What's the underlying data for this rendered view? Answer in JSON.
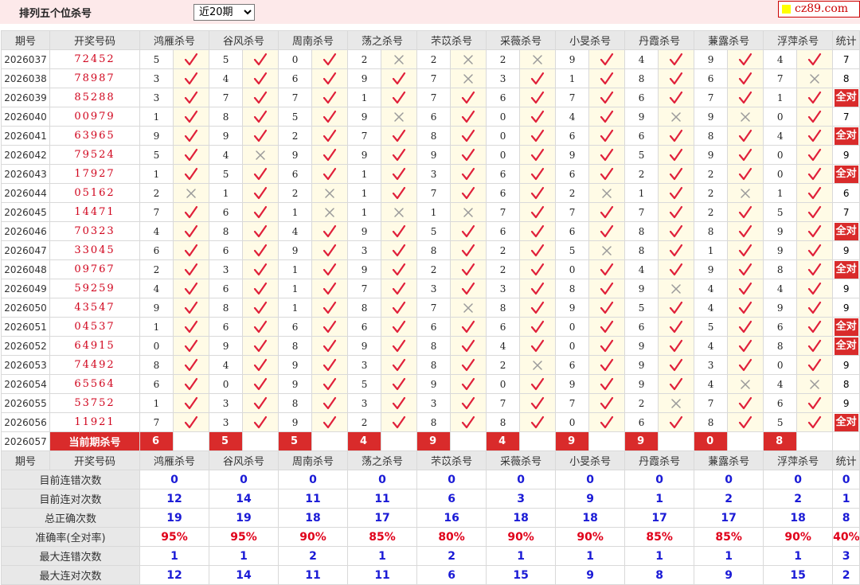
{
  "page_title": "排列五个位杀号",
  "period_select": {
    "selected": "近20期",
    "options": [
      "近20期"
    ]
  },
  "logo": {
    "text": "cz89.com"
  },
  "header": {
    "period": "期号",
    "draw": "开奖号码",
    "experts": [
      "鸿雁杀号",
      "谷风杀号",
      "周南杀号",
      "荡之杀号",
      "芣苡杀号",
      "采薇杀号",
      "小旻杀号",
      "丹霞杀号",
      "蒹露杀号",
      "浮萍杀号"
    ],
    "stat": "统计"
  },
  "rows": [
    {
      "period": "2026037",
      "draw": "72452",
      "kills": [
        5,
        5,
        0,
        2,
        2,
        2,
        9,
        4,
        9,
        4
      ],
      "hits": [
        1,
        1,
        1,
        0,
        0,
        0,
        1,
        1,
        1,
        1
      ],
      "stat": "7"
    },
    {
      "period": "2026038",
      "draw": "78987",
      "kills": [
        3,
        4,
        6,
        9,
        7,
        3,
        1,
        8,
        6,
        7
      ],
      "hits": [
        1,
        1,
        1,
        1,
        0,
        1,
        1,
        1,
        1,
        0
      ],
      "stat": "8"
    },
    {
      "period": "2026039",
      "draw": "85288",
      "kills": [
        3,
        7,
        7,
        1,
        7,
        6,
        7,
        6,
        7,
        1
      ],
      "hits": [
        1,
        1,
        1,
        1,
        1,
        1,
        1,
        1,
        1,
        1
      ],
      "stat": "全对"
    },
    {
      "period": "2026040",
      "draw": "00979",
      "kills": [
        1,
        8,
        5,
        9,
        6,
        0,
        4,
        9,
        9,
        0
      ],
      "hits": [
        1,
        1,
        1,
        0,
        1,
        1,
        1,
        0,
        0,
        1
      ],
      "stat": "7"
    },
    {
      "period": "2026041",
      "draw": "63965",
      "kills": [
        9,
        9,
        2,
        7,
        8,
        0,
        6,
        6,
        8,
        4
      ],
      "hits": [
        1,
        1,
        1,
        1,
        1,
        1,
        1,
        1,
        1,
        1
      ],
      "stat": "全对"
    },
    {
      "period": "2026042",
      "draw": "79524",
      "kills": [
        5,
        4,
        9,
        9,
        9,
        0,
        9,
        5,
        9,
        0
      ],
      "hits": [
        1,
        0,
        1,
        1,
        1,
        1,
        1,
        1,
        1,
        1
      ],
      "stat": "9"
    },
    {
      "period": "2026043",
      "draw": "17927",
      "kills": [
        1,
        5,
        6,
        1,
        3,
        6,
        6,
        2,
        2,
        0
      ],
      "hits": [
        1,
        1,
        1,
        1,
        1,
        1,
        1,
        1,
        1,
        1
      ],
      "stat": "全对"
    },
    {
      "period": "2026044",
      "draw": "05162",
      "kills": [
        2,
        1,
        2,
        1,
        7,
        6,
        2,
        1,
        2,
        1
      ],
      "hits": [
        0,
        1,
        0,
        1,
        1,
        1,
        0,
        1,
        0,
        1
      ],
      "stat": "6"
    },
    {
      "period": "2026045",
      "draw": "14471",
      "kills": [
        7,
        6,
        1,
        1,
        1,
        7,
        7,
        7,
        2,
        5
      ],
      "hits": [
        1,
        1,
        0,
        0,
        0,
        1,
        1,
        1,
        1,
        1
      ],
      "stat": "7"
    },
    {
      "period": "2026046",
      "draw": "70323",
      "kills": [
        4,
        8,
        4,
        9,
        5,
        6,
        6,
        8,
        8,
        9
      ],
      "hits": [
        1,
        1,
        1,
        1,
        1,
        1,
        1,
        1,
        1,
        1
      ],
      "stat": "全对"
    },
    {
      "period": "2026047",
      "draw": "33045",
      "kills": [
        6,
        6,
        9,
        3,
        8,
        2,
        5,
        8,
        1,
        9
      ],
      "hits": [
        1,
        1,
        1,
        1,
        1,
        1,
        0,
        1,
        1,
        1
      ],
      "stat": "9"
    },
    {
      "period": "2026048",
      "draw": "09767",
      "kills": [
        2,
        3,
        1,
        9,
        2,
        2,
        0,
        4,
        9,
        8
      ],
      "hits": [
        1,
        1,
        1,
        1,
        1,
        1,
        1,
        1,
        1,
        1
      ],
      "stat": "全对"
    },
    {
      "period": "2026049",
      "draw": "59259",
      "kills": [
        4,
        6,
        1,
        7,
        3,
        3,
        8,
        9,
        4,
        4
      ],
      "hits": [
        1,
        1,
        1,
        1,
        1,
        1,
        1,
        0,
        1,
        1
      ],
      "stat": "9"
    },
    {
      "period": "2026050",
      "draw": "43547",
      "kills": [
        9,
        8,
        1,
        8,
        7,
        8,
        9,
        5,
        4,
        9
      ],
      "hits": [
        1,
        1,
        1,
        1,
        0,
        1,
        1,
        1,
        1,
        1
      ],
      "stat": "9"
    },
    {
      "period": "2026051",
      "draw": "04537",
      "kills": [
        1,
        6,
        6,
        6,
        6,
        6,
        0,
        6,
        5,
        6
      ],
      "hits": [
        1,
        1,
        1,
        1,
        1,
        1,
        1,
        1,
        1,
        1
      ],
      "stat": "全对"
    },
    {
      "period": "2026052",
      "draw": "64915",
      "kills": [
        0,
        9,
        8,
        9,
        8,
        4,
        0,
        9,
        4,
        8
      ],
      "hits": [
        1,
        1,
        1,
        1,
        1,
        1,
        1,
        1,
        1,
        1
      ],
      "stat": "全对"
    },
    {
      "period": "2026053",
      "draw": "74492",
      "kills": [
        8,
        4,
        9,
        3,
        8,
        2,
        6,
        9,
        3,
        0
      ],
      "hits": [
        1,
        1,
        1,
        1,
        1,
        0,
        1,
        1,
        1,
        1
      ],
      "stat": "9"
    },
    {
      "period": "2026054",
      "draw": "65564",
      "kills": [
        6,
        0,
        9,
        5,
        9,
        0,
        9,
        9,
        4,
        4
      ],
      "hits": [
        1,
        1,
        1,
        1,
        1,
        1,
        1,
        1,
        0,
        0
      ],
      "stat": "8"
    },
    {
      "period": "2026055",
      "draw": "53752",
      "kills": [
        1,
        3,
        8,
        3,
        3,
        7,
        7,
        2,
        7,
        6
      ],
      "hits": [
        1,
        1,
        1,
        1,
        1,
        1,
        1,
        0,
        1,
        1
      ],
      "stat": "9"
    },
    {
      "period": "2026056",
      "draw": "11921",
      "kills": [
        7,
        3,
        9,
        2,
        8,
        8,
        0,
        6,
        8,
        5
      ],
      "hits": [
        1,
        1,
        1,
        1,
        1,
        1,
        1,
        1,
        1,
        1
      ],
      "stat": "全对"
    }
  ],
  "current": {
    "period": "2026057",
    "label": "当前期杀号",
    "kills": [
      "6",
      "5",
      "5",
      "4",
      "9",
      "4",
      "9",
      "9",
      "0",
      "8"
    ]
  },
  "summary": [
    {
      "label": "目前连错次数",
      "values": [
        "0",
        "0",
        "0",
        "0",
        "0",
        "0",
        "0",
        "0",
        "0",
        "0",
        "0"
      ]
    },
    {
      "label": "目前连对次数",
      "values": [
        "12",
        "14",
        "11",
        "11",
        "6",
        "3",
        "9",
        "1",
        "2",
        "2",
        "1"
      ]
    },
    {
      "label": "总正确次数",
      "values": [
        "19",
        "19",
        "18",
        "17",
        "16",
        "18",
        "18",
        "17",
        "17",
        "18",
        "8"
      ]
    },
    {
      "label": "准确率(全对率)",
      "values": [
        "95%",
        "95%",
        "90%",
        "85%",
        "80%",
        "90%",
        "90%",
        "85%",
        "85%",
        "90%",
        "40%"
      ]
    },
    {
      "label": "最大连错次数",
      "values": [
        "1",
        "1",
        "2",
        "1",
        "2",
        "1",
        "1",
        "1",
        "1",
        "1",
        "3"
      ]
    },
    {
      "label": "最大连对次数",
      "values": [
        "12",
        "14",
        "11",
        "11",
        "6",
        "15",
        "9",
        "8",
        "9",
        "15",
        "2"
      ]
    }
  ],
  "colors": {
    "hit": "#e0203a",
    "miss": "#9a9a9a",
    "accent": "#d92b2b",
    "mark_bg": "#fffbe6",
    "header_bg": "#e8e8e8"
  }
}
